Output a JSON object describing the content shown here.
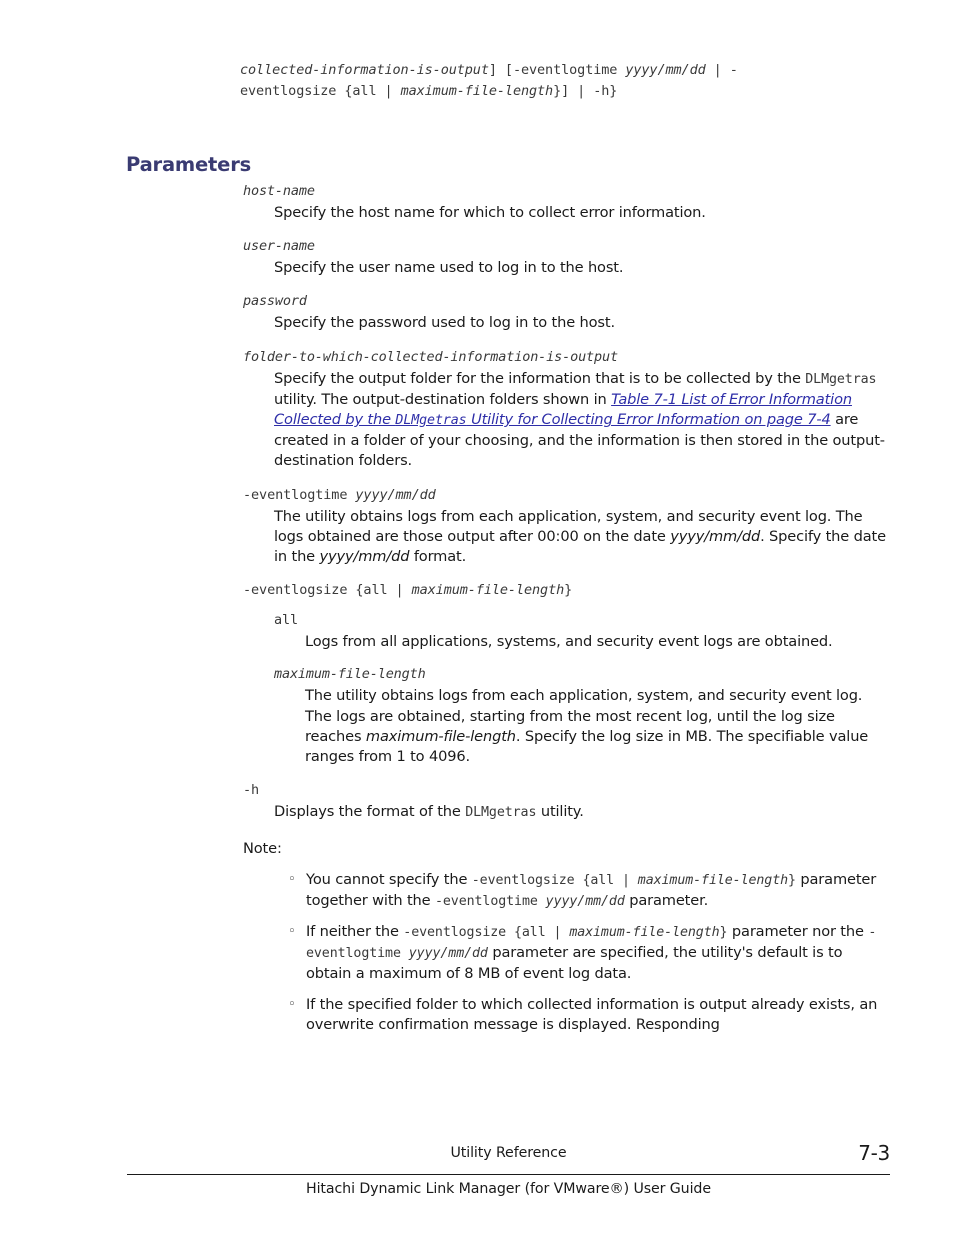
{
  "synopsis": {
    "line1_a": "collected-information-is-output",
    "line1_b": "] [-eventlogtime ",
    "line1_c": "yyyy/mm/dd",
    "line1_d": " | -",
    "line2_a": "eventlogsize {all | ",
    "line2_b": "maximum-file-length",
    "line2_c": "}] | -h}"
  },
  "heading": {
    "title": "Parameters"
  },
  "parameters": [
    {
      "term": "host-name",
      "description": "Specify the host name for which to collect error information."
    },
    {
      "term": "user-name",
      "description": "Specify the user name used to log in to the host."
    },
    {
      "term": "password",
      "description": "Specify the password used to log in to the host."
    }
  ],
  "folder_param": {
    "term": "folder-to-which-collected-information-is-output",
    "text_1": "Specify the output folder for the information that is to be collected by the ",
    "utility_name": "DLMgetras",
    "text_2": " utility. The output-destination folders shown in ",
    "link_1": "Table 7-1 List of Error Information Collected by the ",
    "link_mono": "DLMgetras",
    "link_2": " Utility for Collecting Error Information on page 7-4",
    "text_3": " are created in a folder of your choosing, and the information is then stored in the output-destination folders."
  },
  "eventlogtime_param": {
    "term_cmd": "-eventlogtime ",
    "term_arg": "yyyy/mm/dd",
    "text_1": "The utility obtains logs from each application, system, and security event log. The logs obtained are those output after 00:00 on the date ",
    "date_1": "yyyy/mm/dd",
    "text_2": ". Specify the date in the ",
    "date_2": "yyyy/mm/dd",
    "text_3": " format."
  },
  "eventlogsize_param": {
    "term_cmd": "-eventlogsize {all | ",
    "term_arg": "maximum-file-length",
    "term_end": "}",
    "sub_params": [
      {
        "term": "all",
        "term_style": "mono",
        "description": "Logs from all applications, systems, and security event logs are obtained."
      }
    ],
    "max_file": {
      "term": "maximum-file-length",
      "text_1": "The utility obtains logs from each application, system, and security event log. The logs are obtained, starting from the most recent log, until the log size reaches ",
      "emphasis": "maximum-file-length",
      "text_2": ". Specify the log size in MB. The specifiable value ranges from 1 to 4096."
    }
  },
  "help_param": {
    "term": "-h",
    "text_1": "Displays the format of the ",
    "utility_name": "DLMgetras",
    "text_2": " utility."
  },
  "note": {
    "label": "Note:",
    "bullet_glyph": "◦",
    "items": [
      {
        "t1": "You cannot specify the ",
        "m1": "-eventlogsize {all | ",
        "i1": "maximum-file-length",
        "m2": "}",
        "t2": " parameter together with the ",
        "m3": "-eventlogtime ",
        "i2": "yyyy/mm/dd",
        "t3": " parameter."
      },
      {
        "t1": "If neither the ",
        "m1": "-eventlogsize {all | ",
        "i1": "maximum-file-length",
        "m2": "}",
        "t2": " parameter nor the ",
        "m3": "-eventlogtime ",
        "i2": "yyyy/mm/dd",
        "t3": " parameter are specified, the utility's default is to obtain a maximum of 8 MB of event log data."
      },
      {
        "t1": "If the specified folder to which collected information is output already exists, an overwrite confirmation message is displayed. Responding",
        "m1": "",
        "i1": "",
        "m2": "",
        "t2": "",
        "m3": "",
        "i2": "",
        "t3": ""
      }
    ]
  },
  "footer": {
    "chapter": "Utility Reference",
    "page_number": "7-3",
    "guide_title": "Hitachi Dynamic Link Manager (for VMware®) User Guide"
  },
  "colors": {
    "heading": "#3a3b72",
    "link": "#2e2ea8",
    "body_text": "#1a1a1a",
    "code_text": "#3a3a3a"
  }
}
